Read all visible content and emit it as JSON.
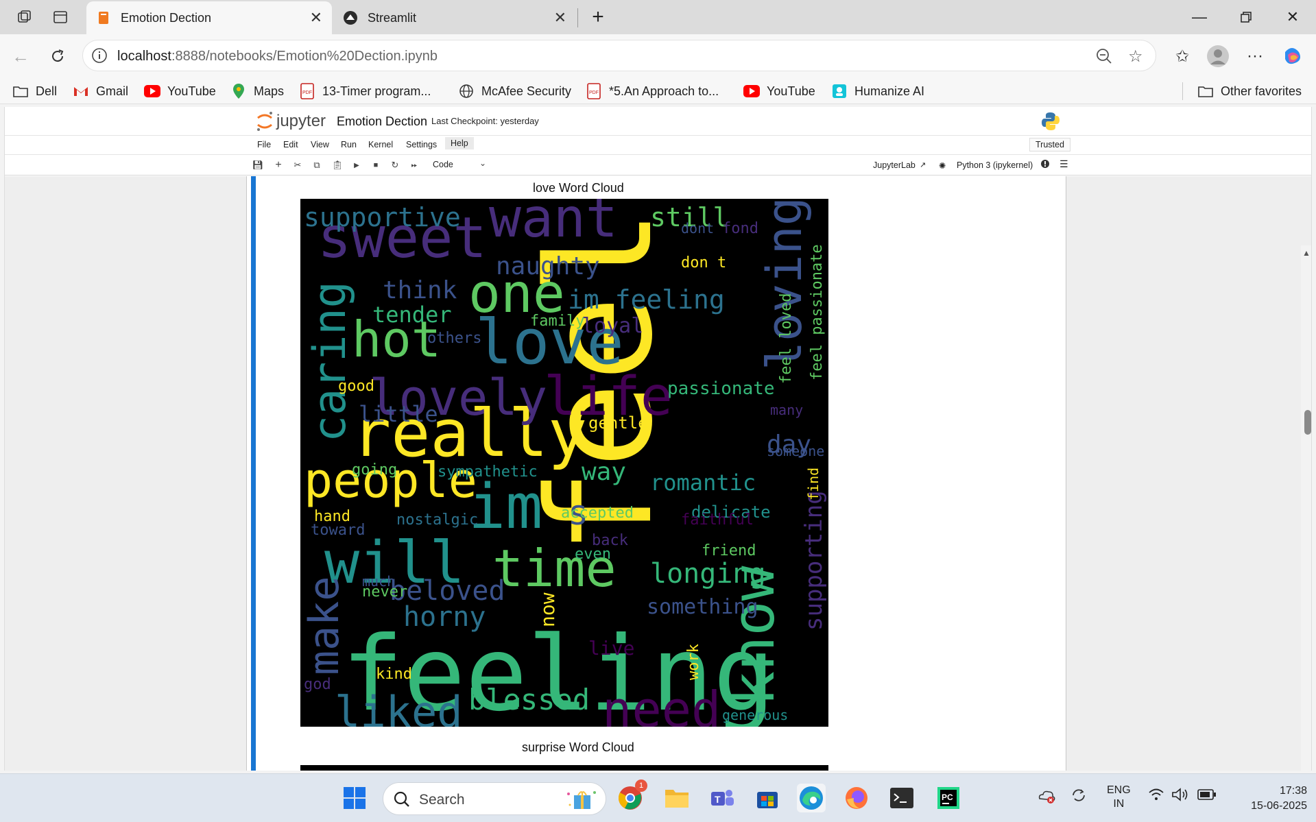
{
  "browser": {
    "tabs": [
      {
        "title": "Emotion Dection",
        "active": true
      },
      {
        "title": "Streamlit",
        "active": false
      }
    ],
    "url_host": "localhost",
    "url_rest": ":8888/notebooks/Emotion%20Dection.ipynb",
    "bookmarks": [
      {
        "label": "Dell",
        "icon": "folder-icon"
      },
      {
        "label": "Gmail",
        "icon": "gmail-icon"
      },
      {
        "label": "YouTube",
        "icon": "youtube-icon"
      },
      {
        "label": "Maps",
        "icon": "maps-icon"
      },
      {
        "label": "13-Timer program...",
        "icon": "pdf-icon"
      },
      {
        "label": "McAfee Security",
        "icon": "globe-icon"
      },
      {
        "label": "*5.An Approach to...",
        "icon": "pdf-icon"
      },
      {
        "label": "YouTube",
        "icon": "youtube-icon"
      },
      {
        "label": "Humanize AI",
        "icon": "humanize-icon"
      }
    ],
    "other_favorites": "Other favorites"
  },
  "jupyter": {
    "logo_text": "jupyter",
    "notebook_title": "Emotion Dection",
    "checkpoint": "Last Checkpoint: yesterday",
    "menu": [
      "File",
      "Edit",
      "View",
      "Run",
      "Kernel",
      "Settings",
      "Help"
    ],
    "trusted": "Trusted",
    "cell_type": "Code",
    "jupyterlab_link": "JupyterLab",
    "kernel": "Python 3 (ipykernel)"
  },
  "output": {
    "love_title": "love Word Cloud",
    "surprise_title": "surprise Word Cloud",
    "words": [
      {
        "t": "feel"
      },
      {
        "t": "feeling"
      },
      {
        "t": "love"
      },
      {
        "t": "really"
      },
      {
        "t": "im"
      },
      {
        "t": "time"
      },
      {
        "t": "people"
      },
      {
        "t": "will"
      },
      {
        "t": "sweet"
      },
      {
        "t": "want"
      },
      {
        "t": "one"
      },
      {
        "t": "hot"
      },
      {
        "t": "lovely"
      },
      {
        "t": "life"
      },
      {
        "t": "caring"
      },
      {
        "t": "loving"
      },
      {
        "t": "know"
      },
      {
        "t": "make"
      },
      {
        "t": "liked"
      },
      {
        "t": "need"
      },
      {
        "t": "blessed"
      },
      {
        "t": "longing"
      },
      {
        "t": "beloved"
      },
      {
        "t": "horny"
      },
      {
        "t": "supportive"
      },
      {
        "t": "still"
      },
      {
        "t": "naughty"
      },
      {
        "t": "im feeling"
      },
      {
        "t": "think"
      },
      {
        "t": "tender"
      },
      {
        "t": "little"
      },
      {
        "t": "loyal"
      },
      {
        "t": "passionate"
      },
      {
        "t": "romantic"
      },
      {
        "t": "day"
      },
      {
        "t": "way"
      },
      {
        "t": "s"
      },
      {
        "t": "supporting"
      },
      {
        "t": "gentle"
      },
      {
        "t": "sympathetic"
      },
      {
        "t": "nostalgic"
      },
      {
        "t": "accepted"
      },
      {
        "t": "delicate"
      },
      {
        "t": "friend"
      },
      {
        "t": "something"
      },
      {
        "t": "now"
      },
      {
        "t": "live"
      },
      {
        "t": "generous"
      },
      {
        "t": "don t"
      },
      {
        "t": "feel passionate"
      },
      {
        "t": "feel loved"
      },
      {
        "t": "fond"
      },
      {
        "t": "dont"
      },
      {
        "t": "good"
      },
      {
        "t": "others"
      },
      {
        "t": "family"
      },
      {
        "t": "going"
      },
      {
        "t": "people"
      },
      {
        "t": "hand"
      },
      {
        "t": "toward"
      },
      {
        "t": "even"
      },
      {
        "t": "back"
      },
      {
        "t": "never"
      },
      {
        "t": "much"
      },
      {
        "t": "kind"
      },
      {
        "t": "god"
      },
      {
        "t": "work"
      },
      {
        "t": "faithful"
      },
      {
        "t": "find"
      },
      {
        "t": "someone"
      },
      {
        "t": "many"
      }
    ]
  },
  "taskbar": {
    "search_label": "Search",
    "lang_top": "ENG",
    "lang_bottom": "IN",
    "time": "17:38",
    "date": "15-06-2025",
    "chrome_badge": "1"
  }
}
